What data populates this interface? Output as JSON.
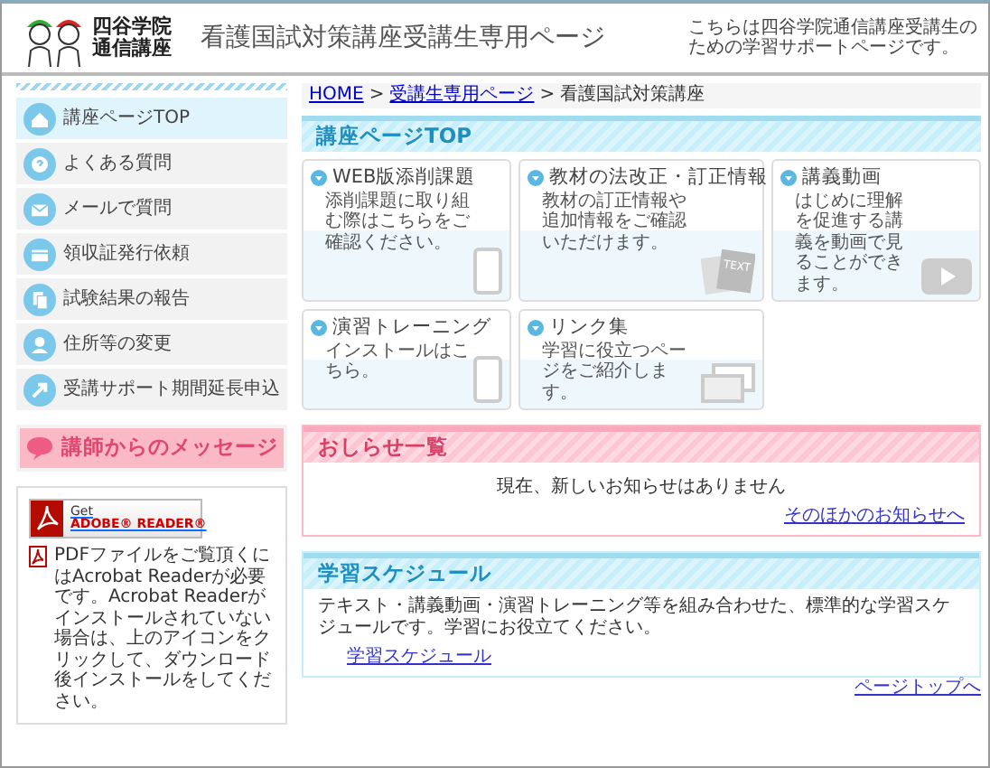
{
  "header": {
    "logo_line1": "四谷学院",
    "logo_line2": "通信講座",
    "title": "看護国試対策講座受講生専用ページ",
    "tagline": "こちらは四谷学院通信講座受講生のための学習サポートページです。"
  },
  "sidebar": {
    "items": [
      {
        "label": "講座ページTOP",
        "selected": true
      },
      {
        "label": "よくある質問",
        "selected": false
      },
      {
        "label": "メールで質問",
        "selected": false
      },
      {
        "label": "領収証発行依頼",
        "selected": false
      },
      {
        "label": "試験結果の報告",
        "selected": false
      },
      {
        "label": "住所等の変更",
        "selected": false
      },
      {
        "label": "受講サポート期間延長申込",
        "selected": false
      }
    ],
    "message_banner": "講師からのメッセージ",
    "adobe": {
      "badge_line1": "Get",
      "badge_line2": "ADOBE® READER®",
      "note": "PDFファイルをご覧頂くにはAcrobat Readerが必要です。Acrobat Readerがインストールされていない場合は、上のアイコンをクリックして、ダウンロード後インストールをしてください。"
    }
  },
  "breadcrumb": [
    {
      "label": "HOME",
      "kind": "link"
    },
    {
      "label": ">",
      "kind": "separator"
    },
    {
      "label": "受講生専用ページ",
      "kind": "link"
    },
    {
      "label": ">",
      "kind": "separator"
    },
    {
      "label": "看護国試対策講座",
      "kind": "current"
    }
  ],
  "section_title": "講座ページTOP",
  "cards": [
    {
      "title": "WEB版添削課題",
      "description": "添削課題に取り組む際はこちらをご確認ください。"
    },
    {
      "title": "教材の法改正・訂正情報",
      "description": "教材の訂正情報や追加情報をご確認いただけます。",
      "illustration_text": "TEXT"
    },
    {
      "title": "講義動画",
      "description": "はじめに理解を促進する講義を動画で見ることができます。"
    },
    {
      "title": "演習トレーニング",
      "description": "インストールはこちら。"
    },
    {
      "title": "リンク集",
      "description": "学習に役立つページをご紹介します。"
    }
  ],
  "notices": {
    "title": "おしらせ一覧",
    "message": "現在、新しいお知らせはありません",
    "more_link": "そのほかのお知らせへ"
  },
  "schedule": {
    "title": "学習スケジュール",
    "text": "テキスト・講義動画・演習トレーニング等を組み合わせた、標準的な学習スケジュールです。学習にお役立てください。",
    "link": "学習スケジュール"
  },
  "page_top_link": "ページトップへ"
}
